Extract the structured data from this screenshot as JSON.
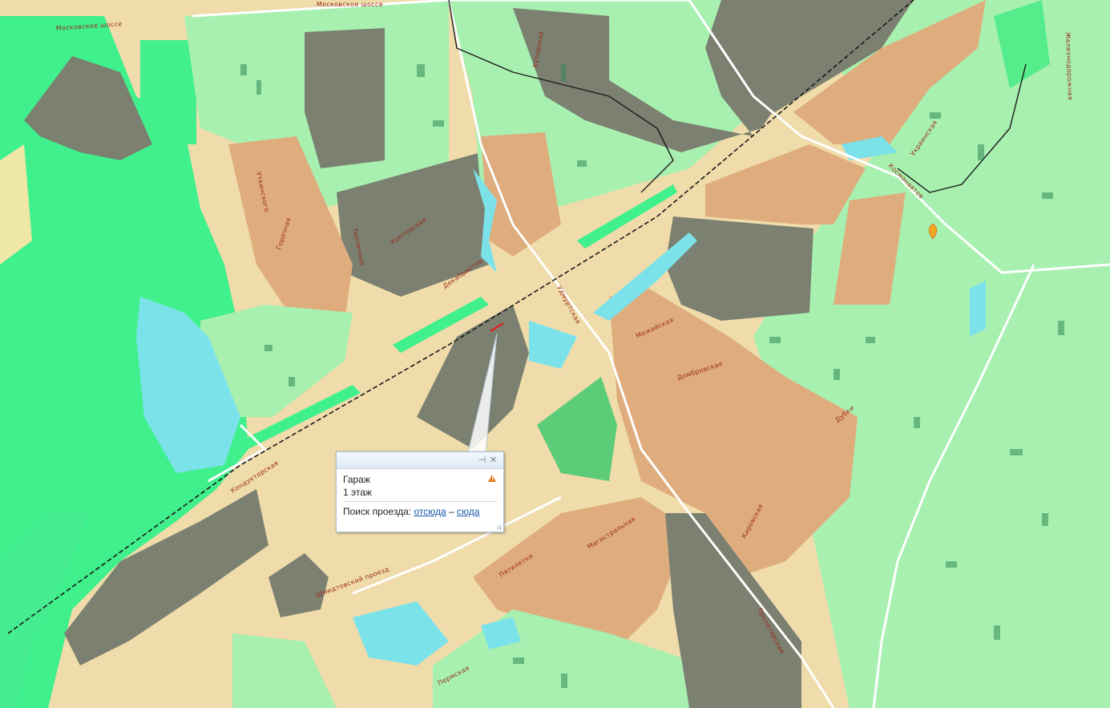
{
  "map": {
    "colors": {
      "background": "#efdcaa",
      "forest": "#3af08a",
      "park": "#55ec8c",
      "residential": "#a8f0b0",
      "industrial": "#7b8070",
      "private_housing": "#dfad7d",
      "water": "#7ce2ea",
      "road": "#ffffff",
      "railway": "#1a1a1a",
      "marker": "#f5a623"
    },
    "street_labels": {
      "moskovskoe_1": "Московское шоссе",
      "moskovskoe_2": "Московское шоссе",
      "gorochaya": "Горочная",
      "utkina": "Уткинского",
      "teplichnaya": "Тепличная",
      "dekabristov": "Декабристов",
      "khutorskaya": "Хуторская",
      "kopteva": "Коптевская",
      "mozhayskaya": "Можайская",
      "dombrovskaya": "Домбровская",
      "udmurtskaya": "Удмуртская",
      "kondukotorskaya": "Кондукторская",
      "magistralnaya": "Магистральная",
      "pyatiletki": "Пятилетки",
      "kirovskaya": "Кировская",
      "proletarskaya": "Пролетарская",
      "dubki": "Дубки",
      "kosmonavtov": "Космонавтов",
      "ukrainskaya": "Украинская",
      "pyrmskaya": "Пермская",
      "shmidta": "Шмидтовский проезд",
      "zheleznodorozhnaya": "Железнодорожная"
    }
  },
  "popup": {
    "title": "Гараж",
    "subtitle": "1 этаж",
    "route_prefix": "Поиск проезда:",
    "route_from": "отсюда",
    "route_dash": "–",
    "route_to": "сюда",
    "pin_icon": "pin-icon",
    "close_icon": "close-icon",
    "warning_icon": "warning-icon"
  }
}
